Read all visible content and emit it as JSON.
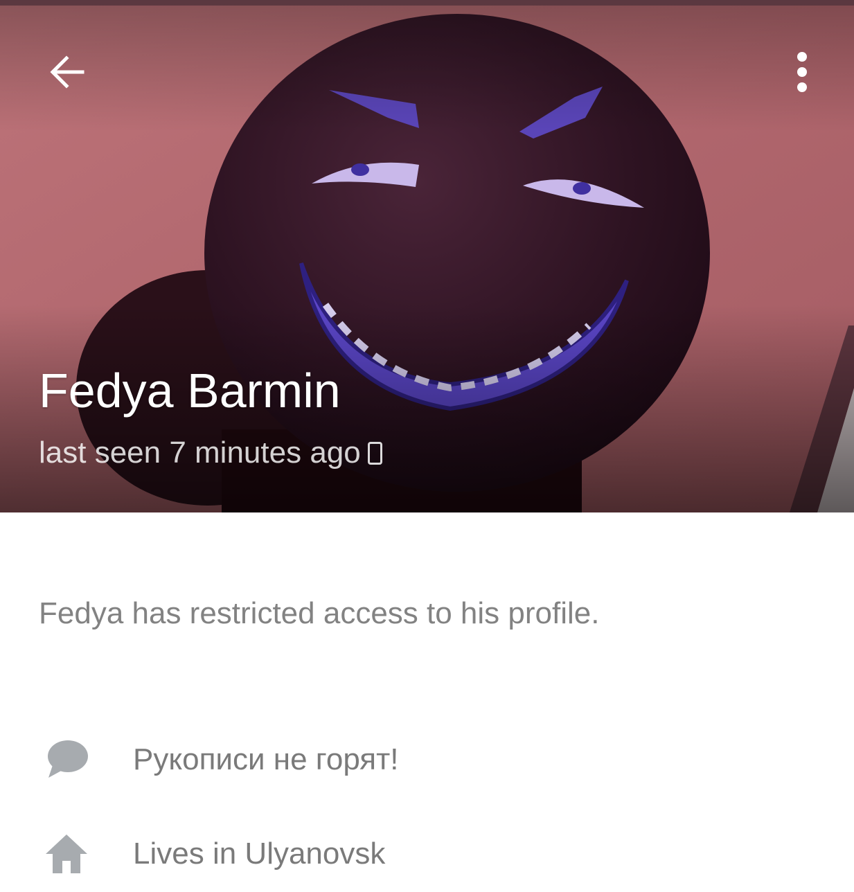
{
  "header": {
    "back_icon": "arrow-left-icon",
    "menu_icon": "more-vertical-icon",
    "name": "Fedya Barmin",
    "last_seen": "last seen 7 minutes ago",
    "device_icon": "mobile-phone-icon",
    "background_color": "#b46a72"
  },
  "profile": {
    "restricted_note": "Fedya has restricted access to his profile."
  },
  "info": [
    {
      "icon": "speech-bubble-icon",
      "text": "Рукописи не горят!"
    },
    {
      "icon": "home-icon",
      "text": "Lives in Ulyanovsk"
    }
  ],
  "colors": {
    "secondary_text": "#828282",
    "icon_gray": "#a7abaf"
  }
}
